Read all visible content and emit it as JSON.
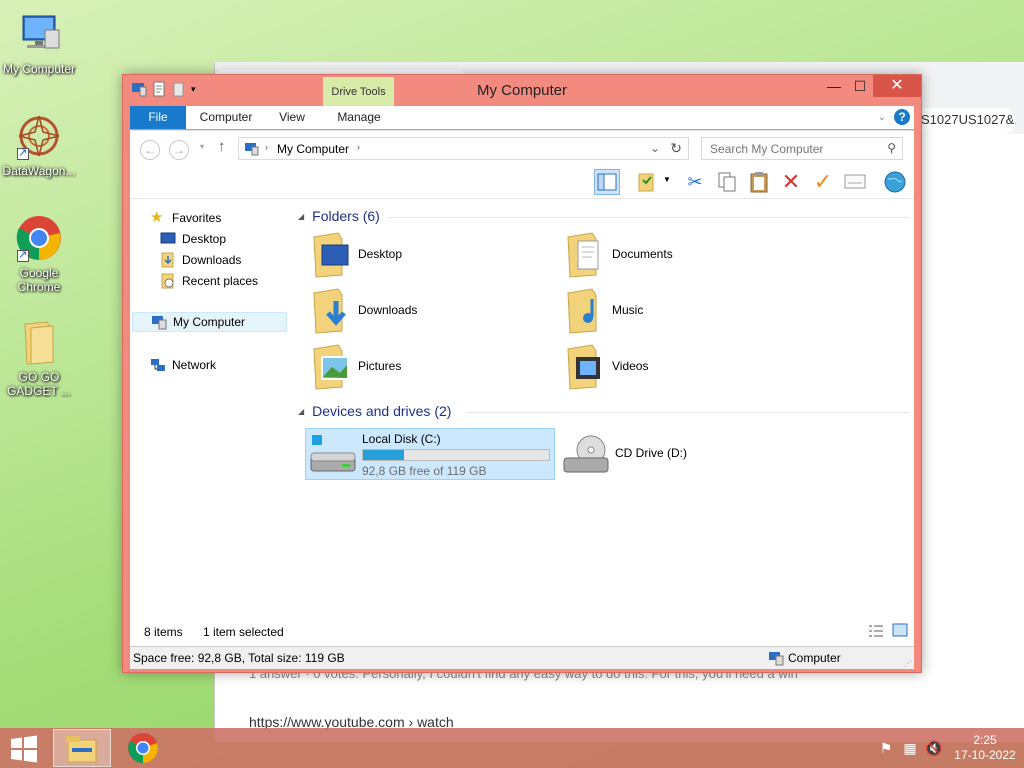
{
  "desktop": {
    "icons": [
      {
        "label": "My Computer"
      },
      {
        "label": "DataWagon..."
      },
      {
        "label": "Google Chrome"
      },
      {
        "label": "GO GO GADGET ..."
      }
    ]
  },
  "background_browser": {
    "url_fragment": "S1027US1027&...",
    "snippet_text": "https://www.youtube.com › watch",
    "snippet_partial": "1 answer · 0 votes: Personally, I couldn't find any easy way to do this. For this, you'll need a win"
  },
  "explorer": {
    "title": "My Computer",
    "context_tab": "Drive Tools",
    "window_buttons": {
      "minimize": "—",
      "maximize": "☐",
      "close": "✕"
    },
    "ribbon_tabs": [
      "File",
      "Computer",
      "View",
      "Manage"
    ],
    "address_crumb": "My Computer",
    "search_placeholder": "Search My Computer",
    "nav": {
      "favorites": "Favorites",
      "favorites_items": [
        "Desktop",
        "Downloads",
        "Recent places"
      ],
      "my_computer": "My Computer",
      "network": "Network"
    },
    "folders_header": "Folders (6)",
    "folders": [
      {
        "name": "Desktop",
        "icon": "desktop-folder-icon"
      },
      {
        "name": "Documents",
        "icon": "documents-folder-icon"
      },
      {
        "name": "Downloads",
        "icon": "downloads-folder-icon"
      },
      {
        "name": "Music",
        "icon": "music-folder-icon"
      },
      {
        "name": "Pictures",
        "icon": "pictures-folder-icon"
      },
      {
        "name": "Videos",
        "icon": "videos-folder-icon"
      }
    ],
    "drives_header": "Devices and drives (2)",
    "drives": [
      {
        "name": "Local Disk (C:)",
        "free_text": "92,8 GB free of 119 GB",
        "used_fraction": 0.22,
        "selected": true
      },
      {
        "name": "CD Drive (D:)"
      }
    ],
    "status": {
      "items": "8 items",
      "selected": "1 item selected"
    },
    "details": {
      "space": "Space free: 92,8 GB, Total size: 119 GB",
      "location": "Computer"
    }
  },
  "taskbar": {
    "clock_time": "2:25",
    "clock_date": "17-10-2022"
  },
  "colors": {
    "window_frame": "#f38a7f",
    "close_button": "#d9554a",
    "file_tab": "#1979ca",
    "drive_tools": "#d8eaa8",
    "drive_bar": "#26a0da"
  }
}
